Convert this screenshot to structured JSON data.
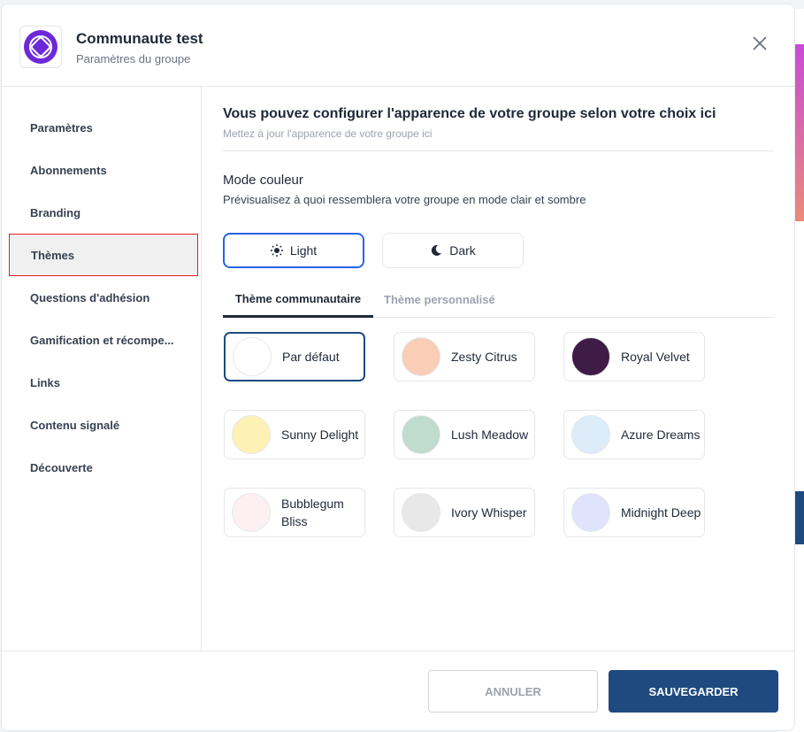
{
  "header": {
    "title": "Communaute test",
    "subtitle": "Paramètres du groupe"
  },
  "sidebar": {
    "items": [
      {
        "label": "Paramètres"
      },
      {
        "label": "Abonnements"
      },
      {
        "label": "Branding"
      },
      {
        "label": "Thèmes",
        "active": true
      },
      {
        "label": "Questions d'adhésion"
      },
      {
        "label": "Gamification et récompe..."
      },
      {
        "label": "Links"
      },
      {
        "label": "Contenu signalé"
      },
      {
        "label": "Découverte"
      }
    ]
  },
  "main": {
    "title": "Vous pouvez configurer l'apparence de votre groupe selon votre choix ici",
    "subtitle": "Mettez à jour l'apparence de votre groupe ici",
    "mode_title": "Mode couleur",
    "mode_desc": "Prévisualisez à quoi ressemblera votre groupe en mode clair et sombre",
    "modes": [
      {
        "label": "Light",
        "icon": "sun-icon",
        "selected": true
      },
      {
        "label": "Dark",
        "icon": "moon-icon"
      }
    ],
    "tabs": [
      {
        "label": "Thème communautaire",
        "active": true
      },
      {
        "label": "Thème personnalisé"
      }
    ],
    "themes": [
      {
        "name": "Par défaut",
        "color": "#ffffff",
        "selected": true
      },
      {
        "name": "Zesty Citrus",
        "color": "#f9cdb6"
      },
      {
        "name": "Royal Velvet",
        "color": "#3f1c45"
      },
      {
        "name": "Sunny Delight",
        "color": "#fdf1b6"
      },
      {
        "name": "Lush Meadow",
        "color": "#bfdccf"
      },
      {
        "name": "Azure Dreams",
        "color": "#dcecf9"
      },
      {
        "name": "Bubblegum Bliss",
        "color": "#fdf0f3"
      },
      {
        "name": "Ivory Whisper",
        "color": "#e8e8e8"
      },
      {
        "name": "Midnight Deep",
        "color": "#dfe3fb"
      }
    ]
  },
  "footer": {
    "cancel": "ANNULER",
    "save": "SAUVEGARDER"
  }
}
